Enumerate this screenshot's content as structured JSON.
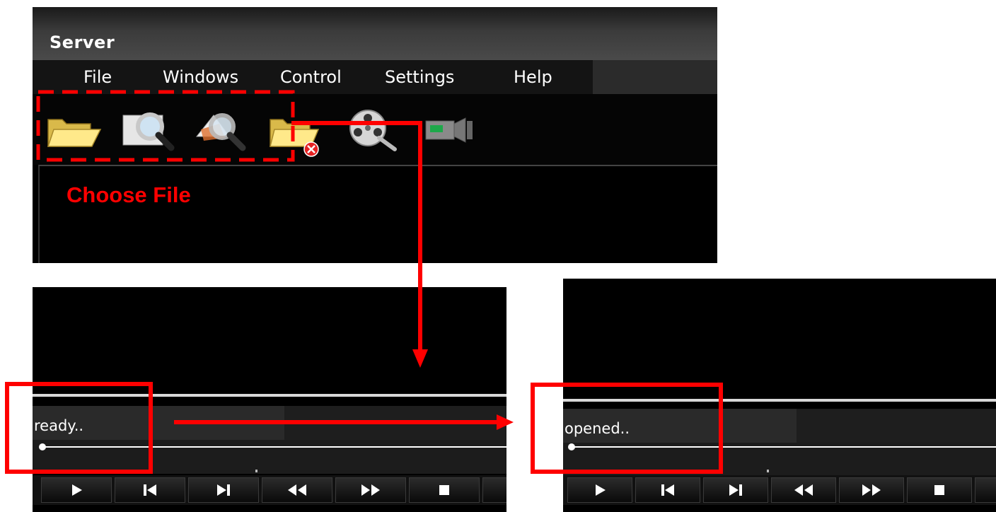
{
  "window": {
    "title": "Server",
    "menu": [
      "File",
      "Windows",
      "Control",
      "Settings",
      "Help"
    ]
  },
  "toolbar": {
    "icons": [
      "open-folder-icon",
      "search-icon",
      "search-image-icon",
      "close-folder-icon",
      "film-reel-icon",
      "video-camera-icon"
    ]
  },
  "annotation": {
    "label": "Choose File",
    "color": "#ff0000"
  },
  "player_before": {
    "status": "ready.."
  },
  "player_after": {
    "status": "opened.."
  },
  "controls": [
    "play-icon",
    "previous-icon",
    "next-icon",
    "rewind-icon",
    "fast-forward-icon",
    "stop-icon"
  ]
}
